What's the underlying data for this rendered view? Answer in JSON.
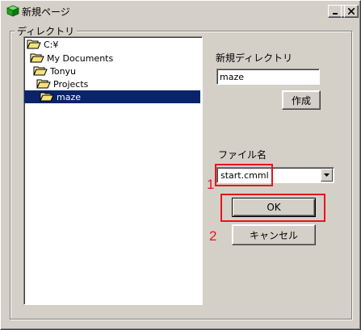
{
  "window": {
    "title": "新規ページ"
  },
  "group": {
    "label": "ディレクトリ"
  },
  "tree": [
    {
      "label": "C:¥",
      "depth": 0,
      "selected": false
    },
    {
      "label": "My Documents",
      "depth": 1,
      "selected": false
    },
    {
      "label": "Tonyu",
      "depth": 2,
      "selected": false
    },
    {
      "label": "Projects",
      "depth": 3,
      "selected": false
    },
    {
      "label": "maze",
      "depth": 4,
      "selected": true
    }
  ],
  "new_dir": {
    "label": "新規ディレクトリ",
    "value": "maze",
    "create_button": "作成"
  },
  "file": {
    "label": "ファイル名",
    "value": "start.cmml"
  },
  "buttons": {
    "ok": "OK",
    "cancel": "キャンセル"
  },
  "annotations": {
    "marker1": "1",
    "marker2": "2",
    "color": "#e8141b"
  },
  "colors": {
    "selection": "#0a246a",
    "face": "#d4d0c8"
  }
}
